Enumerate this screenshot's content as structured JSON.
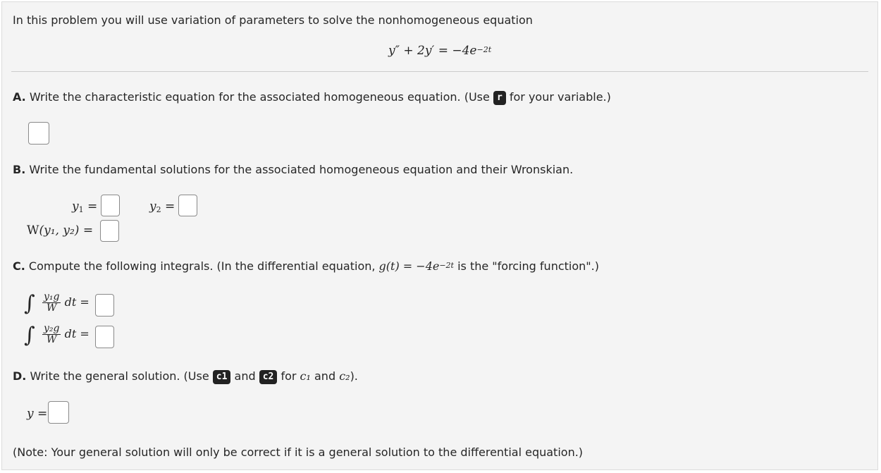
{
  "intro": "In this problem you will use variation of parameters to solve the nonhomogeneous equation",
  "equation": {
    "lhs": "y″ + 2y′",
    "eq": "=",
    "rhs": "−4e",
    "exp": "−2t"
  },
  "partA": {
    "letter": "A.",
    "text_before": " Write the characteristic equation for the associated homogeneous equation. (Use ",
    "chip": "r",
    "text_after": " for your variable.)"
  },
  "partB": {
    "letter": "B.",
    "text": " Write the fundamental solutions for the associated homogeneous equation and their Wronskian.",
    "y1_var": "y",
    "y1_sub": "1",
    "y2_var": "y",
    "y2_sub": "2",
    "w_label": "W",
    "w_args": "(y₁, y₂)",
    "eq": "="
  },
  "partC": {
    "letter": "C.",
    "text_before": " Compute the following integrals. (In the differential equation, ",
    "g_expr": "g(t) = −4e",
    "g_exp": "−2t",
    "text_after": " is the \"forcing function\".)",
    "int1_num": "y₁g",
    "int2_num": "y₂g",
    "den": "W",
    "dt": "dt",
    "eq": "="
  },
  "partD": {
    "letter": "D.",
    "text_before": " Write the general solution. (Use ",
    "chip1": "c1",
    "and": " and ",
    "chip2": "c2",
    "text_mid": " for ",
    "c1": "c₁",
    "and2": " and ",
    "c2": "c₂",
    "text_after": ").",
    "y_label": "y",
    "eq": "="
  },
  "note": "(Note: Your general solution will only be correct if it is a general solution to the differential equation.)"
}
